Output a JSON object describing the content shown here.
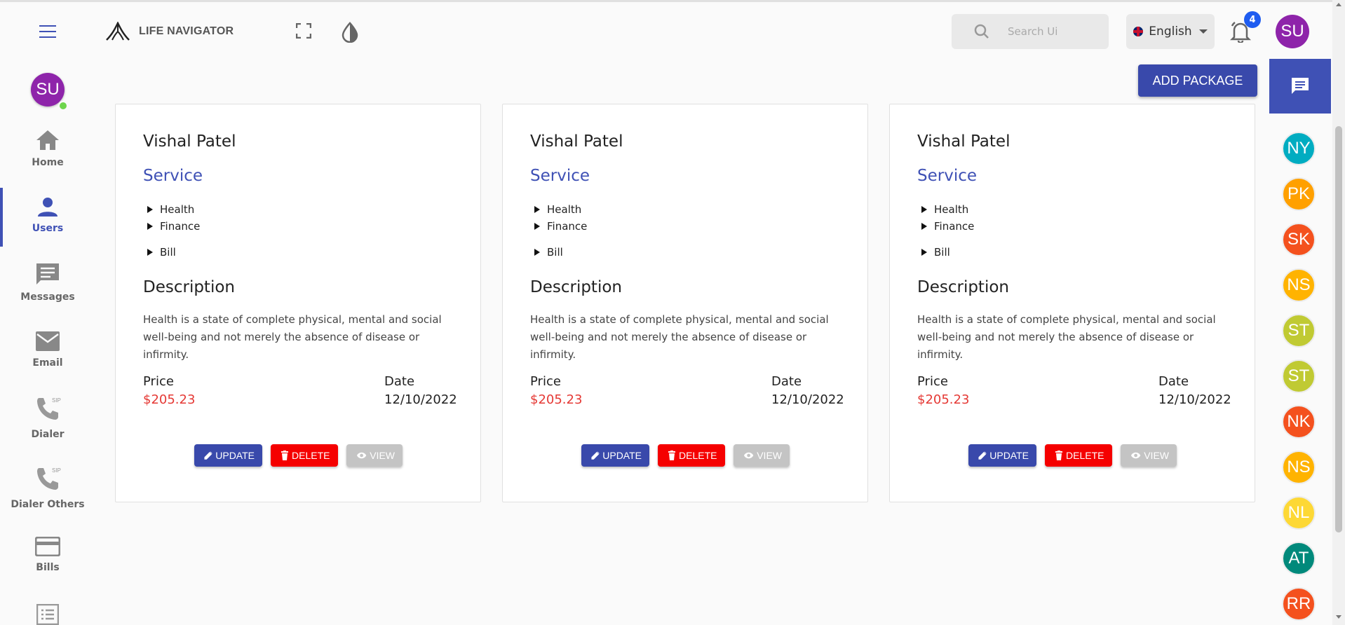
{
  "header": {
    "app_name": "LIFE NAVIGATOR",
    "search_placeholder": "Search Ui",
    "language": "English",
    "notification_count": "4",
    "user_initials": "SU"
  },
  "sidebar": {
    "user_initials": "SU",
    "items": [
      {
        "label": "Home",
        "icon": "home-icon"
      },
      {
        "label": "Users",
        "icon": "user-icon"
      },
      {
        "label": "Messages",
        "icon": "message-icon"
      },
      {
        "label": "Email",
        "icon": "email-icon"
      },
      {
        "label": "Dialer",
        "icon": "sip-phone-icon"
      },
      {
        "label": "Dialer Others",
        "icon": "sip-phone-icon"
      },
      {
        "label": "Bills",
        "icon": "credit-card-icon"
      }
    ]
  },
  "main": {
    "add_button": "ADD PACKAGE",
    "cards": [
      {
        "name": "Vishal Patel",
        "service_title": "Service",
        "services": [
          "Health",
          "Finance",
          "Bill"
        ],
        "description_title": "Description",
        "description": "Health is a state of complete physical, mental and social well-being and not merely the absence of disease or infirmity.",
        "price_label": "Price",
        "price": "$205.23",
        "date_label": "Date",
        "date": "12/10/2022",
        "update": "UPDATE",
        "delete": "DELETE",
        "view": "VIEW"
      },
      {
        "name": "Vishal Patel",
        "service_title": "Service",
        "services": [
          "Health",
          "Finance",
          "Bill"
        ],
        "description_title": "Description",
        "description": "Health is a state of complete physical, mental and social well-being and not merely the absence of disease or infirmity.",
        "price_label": "Price",
        "price": "$205.23",
        "date_label": "Date",
        "date": "12/10/2022",
        "update": "UPDATE",
        "delete": "DELETE",
        "view": "VIEW"
      },
      {
        "name": "Vishal Patel",
        "service_title": "Service",
        "services": [
          "Health",
          "Finance",
          "Bill"
        ],
        "description_title": "Description",
        "description": "Health is a state of complete physical, mental and social well-being and not merely the absence of disease or infirmity.",
        "price_label": "Price",
        "price": "$205.23",
        "date_label": "Date",
        "date": "12/10/2022",
        "update": "UPDATE",
        "delete": "DELETE",
        "view": "VIEW"
      }
    ]
  },
  "contacts": [
    {
      "initials": "NY",
      "color": "#00acc1"
    },
    {
      "initials": "PK",
      "color": "#ffa000"
    },
    {
      "initials": "SK",
      "color": "#f4511e"
    },
    {
      "initials": "NS",
      "color": "#ffb300"
    },
    {
      "initials": "ST",
      "color": "#c0ca33"
    },
    {
      "initials": "ST",
      "color": "#c0ca33"
    },
    {
      "initials": "NK",
      "color": "#f4511e"
    },
    {
      "initials": "NS",
      "color": "#ffb300"
    },
    {
      "initials": "NL",
      "color": "#fdd835"
    },
    {
      "initials": "AT",
      "color": "#00897b"
    },
    {
      "initials": "RR",
      "color": "#f4511e"
    }
  ],
  "colors": {
    "primary": "#3f51b5",
    "danger": "#f50000",
    "price": "#e53935",
    "avatar": "#8e24aa"
  }
}
